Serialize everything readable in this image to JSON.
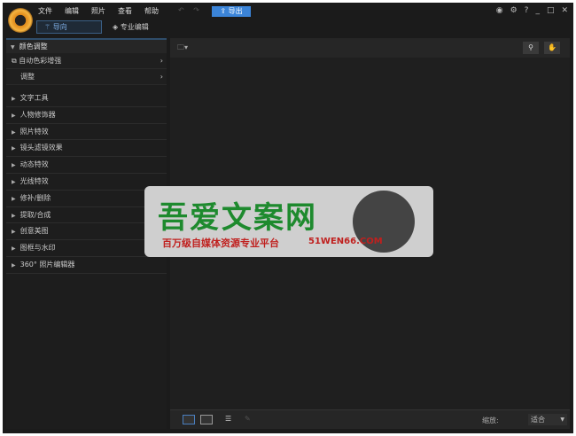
{
  "menu": [
    "文件",
    "编辑",
    "照片",
    "查看",
    "帮助"
  ],
  "undo": "↶ ↷",
  "export": "⇪ 导出",
  "tabs": {
    "guide": "导向",
    "pro": "专业编辑"
  },
  "window_controls": [
    "◉",
    "⚙",
    "?",
    "_",
    "□",
    "✕"
  ],
  "sidebar": {
    "header": "颜色调整",
    "subs": [
      "自动色彩增强",
      "调整"
    ],
    "items": [
      "文字工具",
      "人物修饰器",
      "照片特效",
      "镜头滤镜效果",
      "动态特效",
      "光线特效",
      "修补/删除",
      "提取/合成",
      "创意美图",
      "图框与水印",
      "360° 照片编辑器"
    ]
  },
  "toolbar": {
    "folder": "🗀▾",
    "search": "⚲",
    "hand": "✋"
  },
  "bottom": {
    "zoom_label": "缩放:",
    "zoom_value": "适合"
  },
  "watermark": {
    "title": "吾爱文案网",
    "subtitle": "百万级自媒体资源专业平台",
    "url": "51WEN66.COM"
  }
}
